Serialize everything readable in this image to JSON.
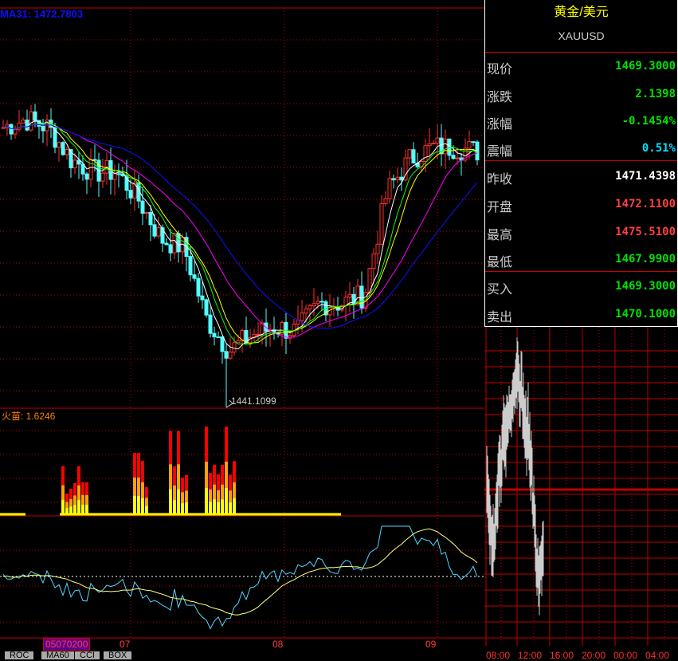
{
  "chart": {
    "ma_label": "MA31: 1472.7803",
    "low_marker": "1441.1099",
    "indicator_label": "火苗: 1.6246",
    "date_cursor": "05070200",
    "date_ticks": [
      "07",
      "08",
      "09"
    ],
    "tabs": [
      "ROC",
      "MA60",
      "CCI",
      "BOX"
    ],
    "price_path": [
      1475.0,
      1476.0,
      1475.0,
      1471.1,
      1469.6,
      1469.6,
      1466.2,
      1461.4,
      1460.4,
      1451.7,
      1447.8,
      1449.7,
      1450.7,
      1450.2,
      1453.6,
      1453.6,
      1454.6,
      1467.2,
      1471.1,
      1472.6,
      1472.6,
      1472.1
    ],
    "fire_clusters": [
      {
        "from": 15,
        "to": 21,
        "peak": 0.55
      },
      {
        "from": 33,
        "to": 36,
        "peak": 0.7
      },
      {
        "from": 42,
        "to": 46,
        "peak": 0.95
      },
      {
        "from": 51,
        "to": 58,
        "peak": 1.0
      }
    ],
    "colors": {
      "up": "#ff3030",
      "down": "#54ffff",
      "grid": "#c00000",
      "ma_blue": "#1010ff"
    }
  },
  "quote": {
    "title": "黄金/美元",
    "code": "XAUUSD",
    "rows": [
      {
        "label": "现价",
        "value": "1469.3000",
        "color": "#00e000"
      },
      {
        "label": "涨跌",
        "value": "2.1398",
        "color": "#00e000"
      },
      {
        "label": "涨幅",
        "value": "-0.1454%",
        "color": "#00e000"
      },
      {
        "label": "震幅",
        "value": "0.51%",
        "color": "#00e0ff"
      },
      {
        "label": "昨收",
        "value": "1471.4398",
        "color": "#ffffff"
      },
      {
        "label": "开盘",
        "value": "1472.1100",
        "color": "#ff4040"
      },
      {
        "label": "最高",
        "value": "1475.5100",
        "color": "#ff4040"
      },
      {
        "label": "最低",
        "value": "1467.9900",
        "color": "#00e000"
      },
      {
        "label": "买入",
        "value": "1469.3000",
        "color": "#00e000"
      },
      {
        "label": "卖出",
        "value": "1470.1000",
        "color": "#00e000"
      }
    ]
  },
  "intraday": {
    "time_ticks": [
      "08:00",
      "12:00",
      "16:00",
      "20:00",
      "00:00",
      "04:00"
    ]
  }
}
